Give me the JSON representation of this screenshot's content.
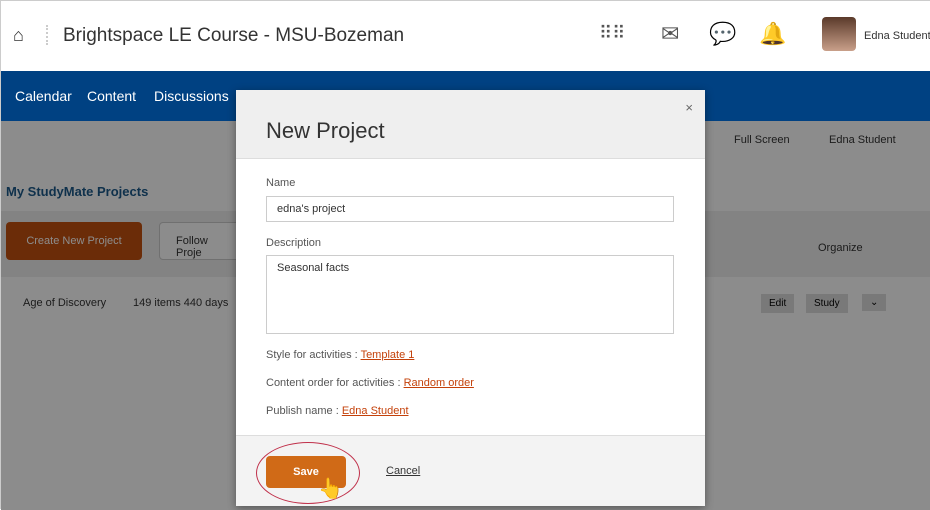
{
  "header": {
    "title": "Brightspace LE Course - MSU-Bozeman",
    "user": "Edna Student"
  },
  "nav": {
    "items": [
      "Calendar",
      "Content",
      "Discussions"
    ]
  },
  "page": {
    "full_screen": "Full Screen",
    "user": "Edna Student",
    "heading": "My StudyMate Projects",
    "create_button": "Create New Project",
    "follow_button": "Follow Proje",
    "organize": "Organize",
    "project": {
      "name": "Age of Discovery",
      "meta": "149 items 440 days"
    },
    "edit": "Edit",
    "study": "Study"
  },
  "modal": {
    "title": "New Project",
    "close": "×",
    "name_label": "Name",
    "name_value": "edna's project",
    "description_label": "Description",
    "description_value": "Seasonal facts",
    "style_label": "Style for activities : ",
    "style_value": "Template 1",
    "order_label": "Content order for activities : ",
    "order_value": "Random order",
    "publish_label": "Publish name : ",
    "publish_value": "Edna Student",
    "save": "Save",
    "cancel": "Cancel"
  }
}
